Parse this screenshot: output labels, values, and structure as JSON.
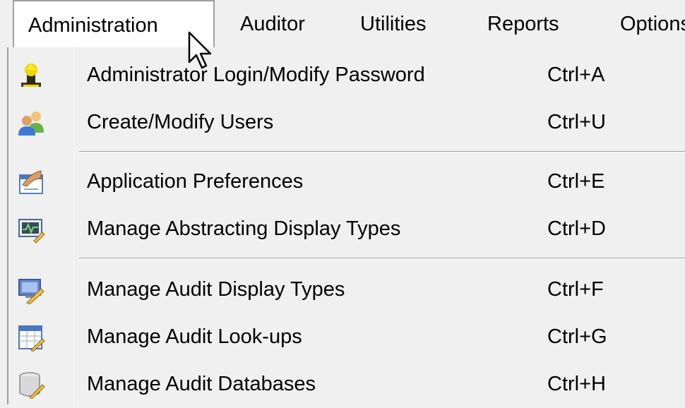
{
  "menubar": {
    "items": [
      {
        "label": "Administration"
      },
      {
        "label": "Auditor"
      },
      {
        "label": "Utilities"
      },
      {
        "label": "Reports"
      },
      {
        "label": "Options"
      }
    ]
  },
  "dropdown": {
    "items": [
      {
        "label": "Administrator Login/Modify Password",
        "shortcut": "Ctrl+A",
        "icon": "admin-login-icon"
      },
      {
        "label": "Create/Modify Users",
        "shortcut": "Ctrl+U",
        "icon": "users-icon"
      },
      {
        "label": "Application Preferences",
        "shortcut": "Ctrl+E",
        "icon": "preferences-icon"
      },
      {
        "label": "Manage Abstracting Display Types",
        "shortcut": "Ctrl+D",
        "icon": "display-types-icon"
      },
      {
        "label": "Manage Audit Display Types",
        "shortcut": "Ctrl+F",
        "icon": "audit-display-icon"
      },
      {
        "label": "Manage Audit Look-ups",
        "shortcut": "Ctrl+G",
        "icon": "lookups-icon"
      },
      {
        "label": "Manage Audit Databases",
        "shortcut": "Ctrl+H",
        "icon": "database-icon"
      }
    ]
  }
}
